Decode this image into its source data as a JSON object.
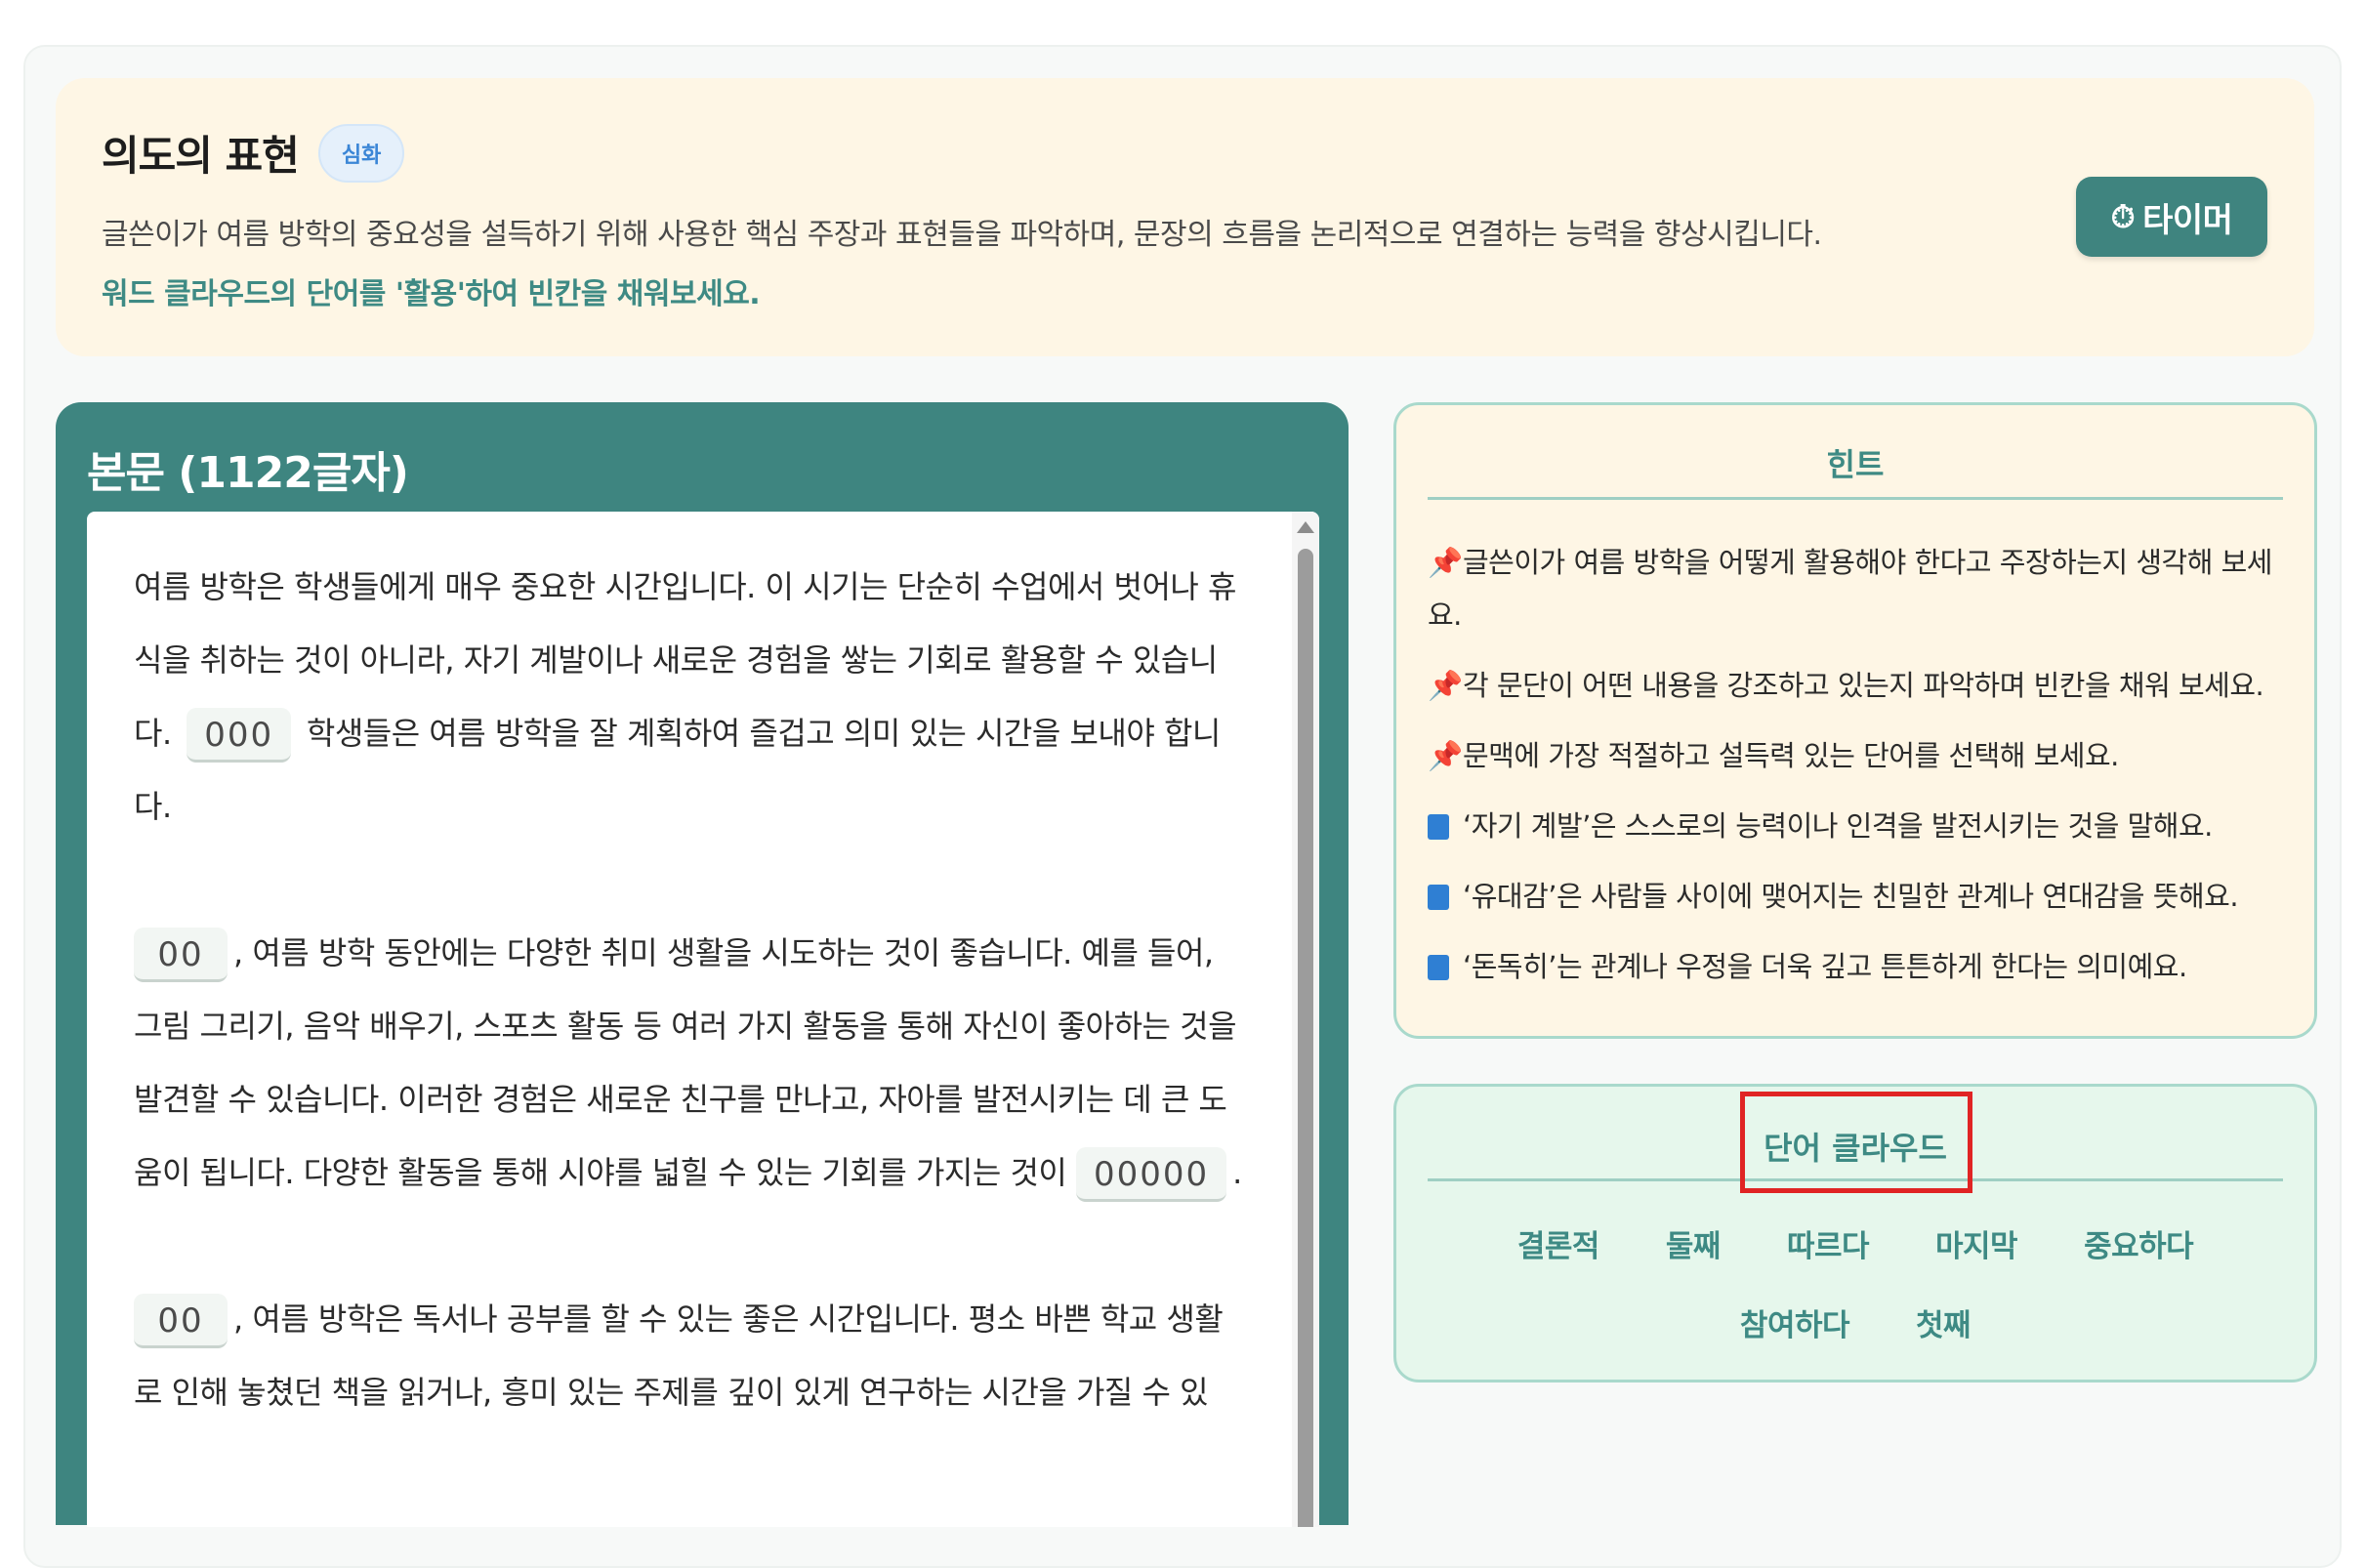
{
  "header": {
    "title": "의도의 표현",
    "badge": "심화",
    "description": "글쓴이가 여름 방학의 중요성을 설득하기 위해 사용한 핵심 주장과 표현들을 파악하며, 문장의 흐름을 논리적으로 연결하는 능력을 향상시킵니다.",
    "instruction": "워드 클라우드의 단어를 '활용'하여 빈칸을 채워보세요.",
    "timer_icon": "⏱",
    "timer_label": "타이머"
  },
  "passage": {
    "title": "본문 (1122글자)",
    "p1": {
      "a": "여름 방학은 학생들에게 매우 중요한 시간입니다. 이 시기는 단순히 수업에서 벗어나 휴식을 취하는 것이 아니라, 자기 계발이나 새로운 경험을 쌓는 기회로 활용할 수 있습니다. ",
      "blank": "000",
      "b": " 학생들은 여름 방학을 잘 계획하여 즐겁고 의미 있는 시간을 보내야 합니다."
    },
    "p2": {
      "blank1": "00",
      "a": ", 여름 방학 동안에는 다양한 취미 생활을 시도하는 것이 좋습니다. 예를 들어, 그림 그리기, 음악 배우기, 스포츠 활동 등 여러 가지 활동을 통해 자신이 좋아하는 것을 발견할 수 있습니다. 이러한 경험은 새로운 친구를 만나고, 자아를 발전시키는 데 큰 도움이 됩니다. 다양한 활동을 통해 시야를 넓힐 수 있는 기회를 가지는 것이 ",
      "blank2": "00000",
      "b": "."
    },
    "p3": {
      "blank": "00",
      "a": ", 여름 방학은 독서나 공부를 할 수 있는 좋은 시간입니다. 평소 바쁜 학교 생활로 인해 놓쳤던 책을 읽거나, 흥미 있는 주제를 깊이 있게 연구하는 시간을 가질 수 있"
    }
  },
  "hints": {
    "title": "힌트",
    "pin_icon": "📌",
    "items": [
      "글쓴이가 여름 방학을 어떻게 활용해야 한다고 주장하는지 생각해 보세요.",
      "각 문단이 어떤 내용을 강조하고 있는지 파악하며 빈칸을 채워 보세요.",
      "문맥에 가장 적절하고 설득력 있는 단어를 선택해 보세요.",
      "‘자기 계발’은 스스로의 능력이나 인격을 발전시키는 것을 말해요.",
      "‘유대감’은 사람들 사이에 맺어지는 친밀한 관계나 연대감을 뜻해요.",
      "‘돈독히’는 관계나 우정을 더욱 깊고 튼튼하게 한다는 의미예요."
    ]
  },
  "word_cloud": {
    "title": "단어 클라우드",
    "row1": [
      "결론적",
      "둘째",
      "따르다",
      "마지막",
      "중요하다"
    ],
    "row2": [
      "참여하다",
      "첫째"
    ]
  }
}
